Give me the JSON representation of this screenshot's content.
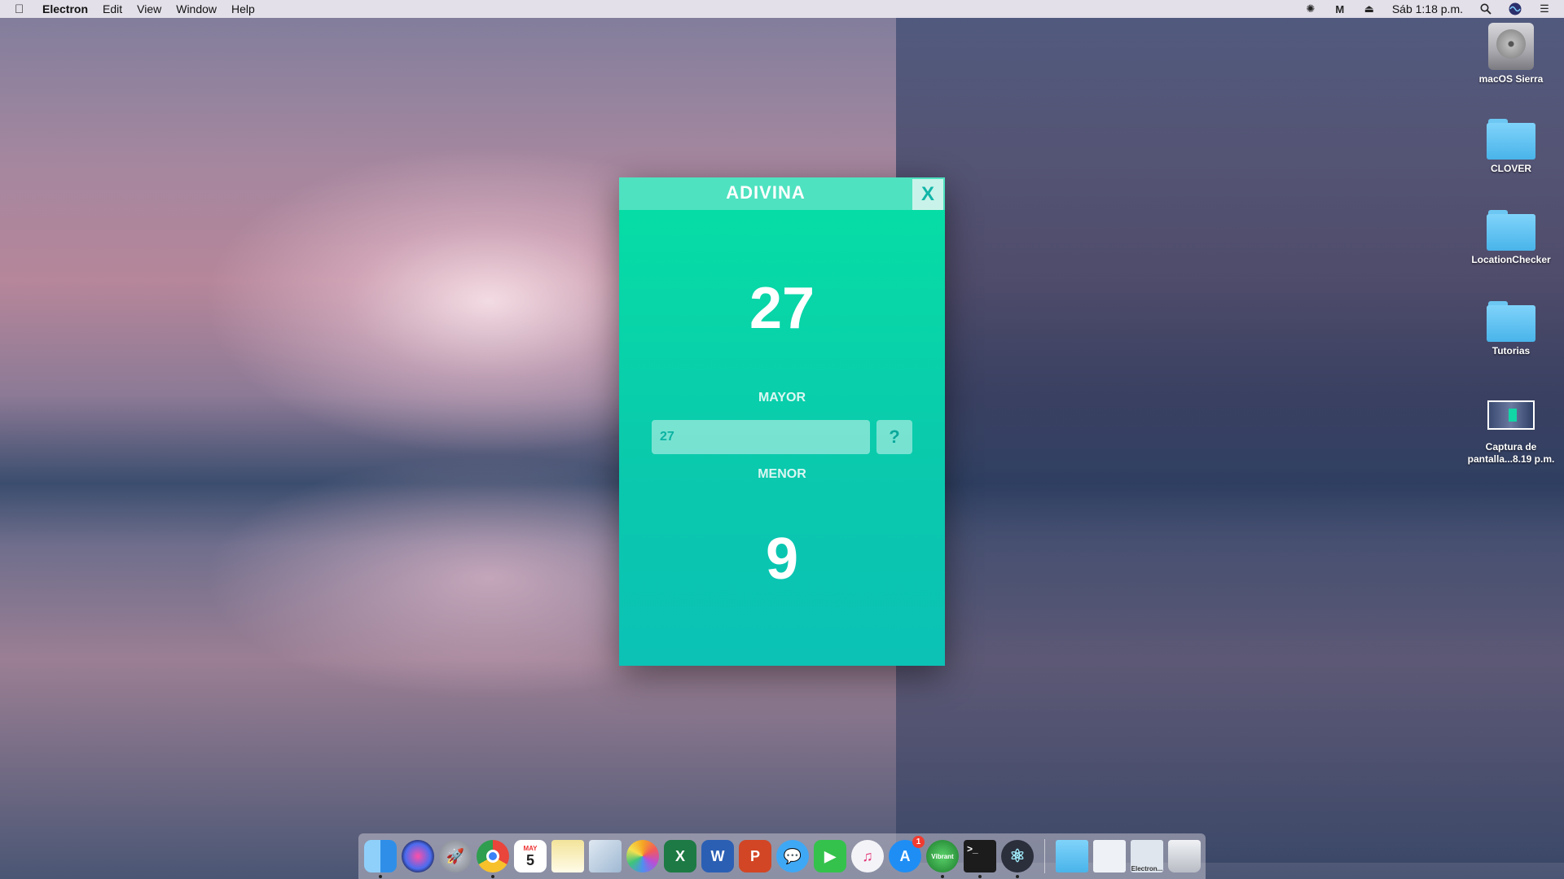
{
  "menubar": {
    "app_name": "Electron",
    "items": [
      "Edit",
      "View",
      "Window",
      "Help"
    ],
    "clock": "Sáb 1:18 p.m."
  },
  "desktop": {
    "icons": [
      {
        "label": "macOS Sierra",
        "icon": "hard-drive-icon"
      },
      {
        "label": "CLOVER",
        "icon": "folder-icon"
      },
      {
        "label": "LocationChecker",
        "icon": "folder-icon"
      },
      {
        "label": "Tutorias",
        "icon": "folder-icon"
      },
      {
        "label_line1": "Captura de",
        "label_line2": "pantalla...8.19 p.m.",
        "icon": "screenshot-thumbnail-icon"
      }
    ]
  },
  "game_window": {
    "title": "ADIVINA",
    "close_label": "X",
    "upper_value": "27",
    "upper_hint": "MAYOR",
    "input_value": "27",
    "guess_button_label": "?",
    "lower_hint": "MENOR",
    "lower_value": "9"
  },
  "dock": {
    "apps": [
      {
        "name": "finder-icon",
        "color": "#2f8fe8"
      },
      {
        "name": "siri-icon",
        "color": "#3a2f7a"
      },
      {
        "name": "launchpad-icon",
        "color": "#8a8f99"
      },
      {
        "name": "chrome-icon",
        "color": "#e9453a"
      },
      {
        "name": "calendar-icon",
        "color": "#ffffff"
      },
      {
        "name": "notes-icon",
        "color": "#f6e48a"
      },
      {
        "name": "preview-icon",
        "color": "#c9d9e9"
      },
      {
        "name": "photos-icon",
        "color": "#f5a623"
      },
      {
        "name": "excel-icon",
        "color": "#1d7a44"
      },
      {
        "name": "word-icon",
        "color": "#2b5fb4"
      },
      {
        "name": "powerpoint-icon",
        "color": "#d24625"
      },
      {
        "name": "messages-icon",
        "color": "#3fa8f5"
      },
      {
        "name": "facetime-icon",
        "color": "#34c24c"
      },
      {
        "name": "itunes-icon",
        "color": "#f0f0f5"
      },
      {
        "name": "app-store-icon",
        "color": "#1e8ef5"
      },
      {
        "name": "vibrant-icon",
        "color": "#1a7a2a"
      },
      {
        "name": "terminal-icon",
        "color": "#1c1c1c"
      },
      {
        "name": "electron-icon",
        "color": "#2b2e3b"
      }
    ],
    "app_store_badge": "1",
    "vibrant_label": "Vibrant",
    "calendar_month": "MAY",
    "calendar_day": "5",
    "electron_thumb_label": "Electron..."
  }
}
